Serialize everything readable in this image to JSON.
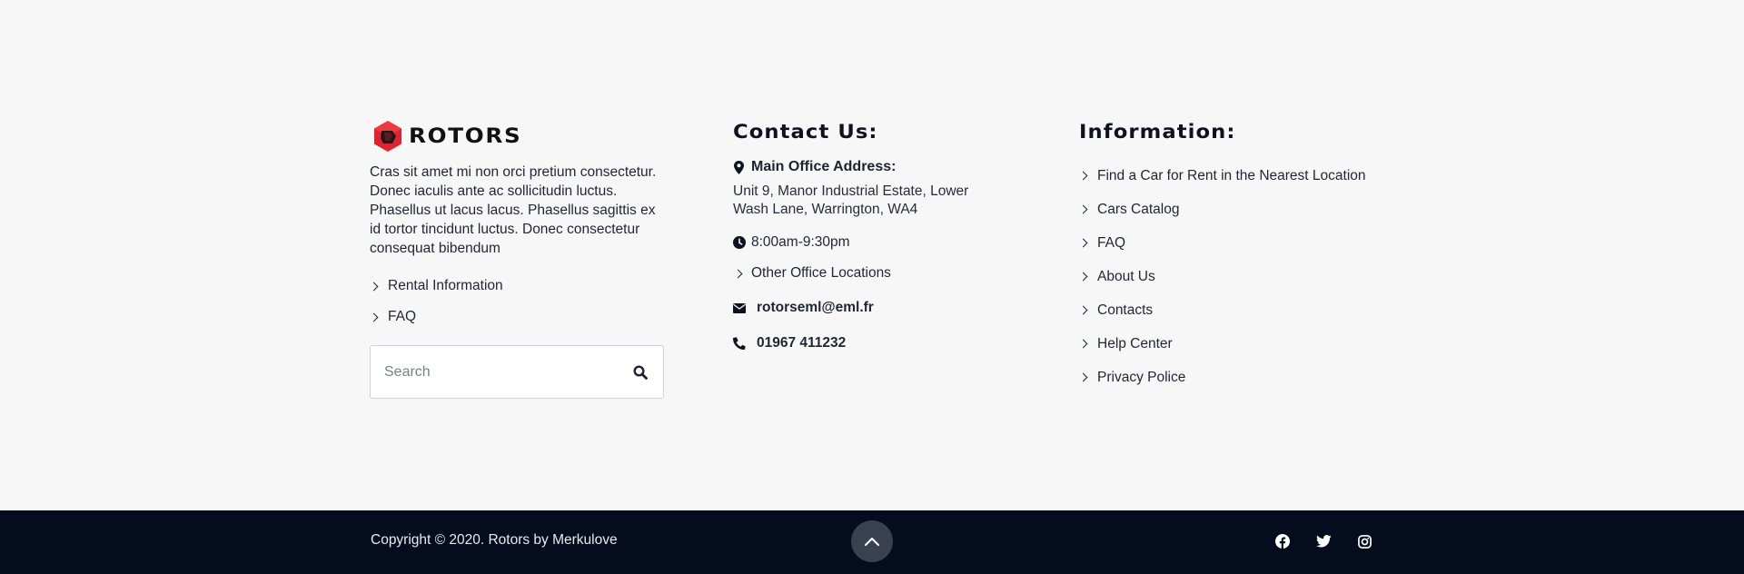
{
  "brand": {
    "name": "ROTORS",
    "logo_icon": "hexagon-logo-icon",
    "accent": "#e0232e"
  },
  "about": {
    "text": "Cras sit amet mi non orci pretium consectetur. Donec iaculis ante ac sollicitudin luctus. Phasellus ut lacus lacus. Phasellus sagittis ex id tortor tincidunt luctus. Donec consectetur consequat bibendum",
    "links": [
      "Rental Information",
      "FAQ"
    ]
  },
  "search": {
    "placeholder": "Search",
    "value": "",
    "icon": "search-icon"
  },
  "contact": {
    "heading": "Contact Us:",
    "office_label": "Main Office Address:",
    "office_address": "Unit 9, Manor Industrial Estate, Lower Wash Lane, Warrington, WA4",
    "hours": "8:00am-9:30pm",
    "other_offices": "Other Office Locations",
    "email": "rotorseml@eml.fr",
    "phone": "01967 411232"
  },
  "information": {
    "heading": "Information:",
    "links": [
      "Find a Car for Rent in the Nearest Location",
      "Cars Catalog",
      "FAQ",
      "About Us",
      "Contacts",
      "Help Center",
      "Privacy Police"
    ]
  },
  "footer": {
    "copyright": "Copyright © 2020. Rotors  by Merkulove",
    "background": "#050c1d",
    "socials": [
      "facebook-icon",
      "twitter-icon",
      "instagram-icon"
    ]
  }
}
